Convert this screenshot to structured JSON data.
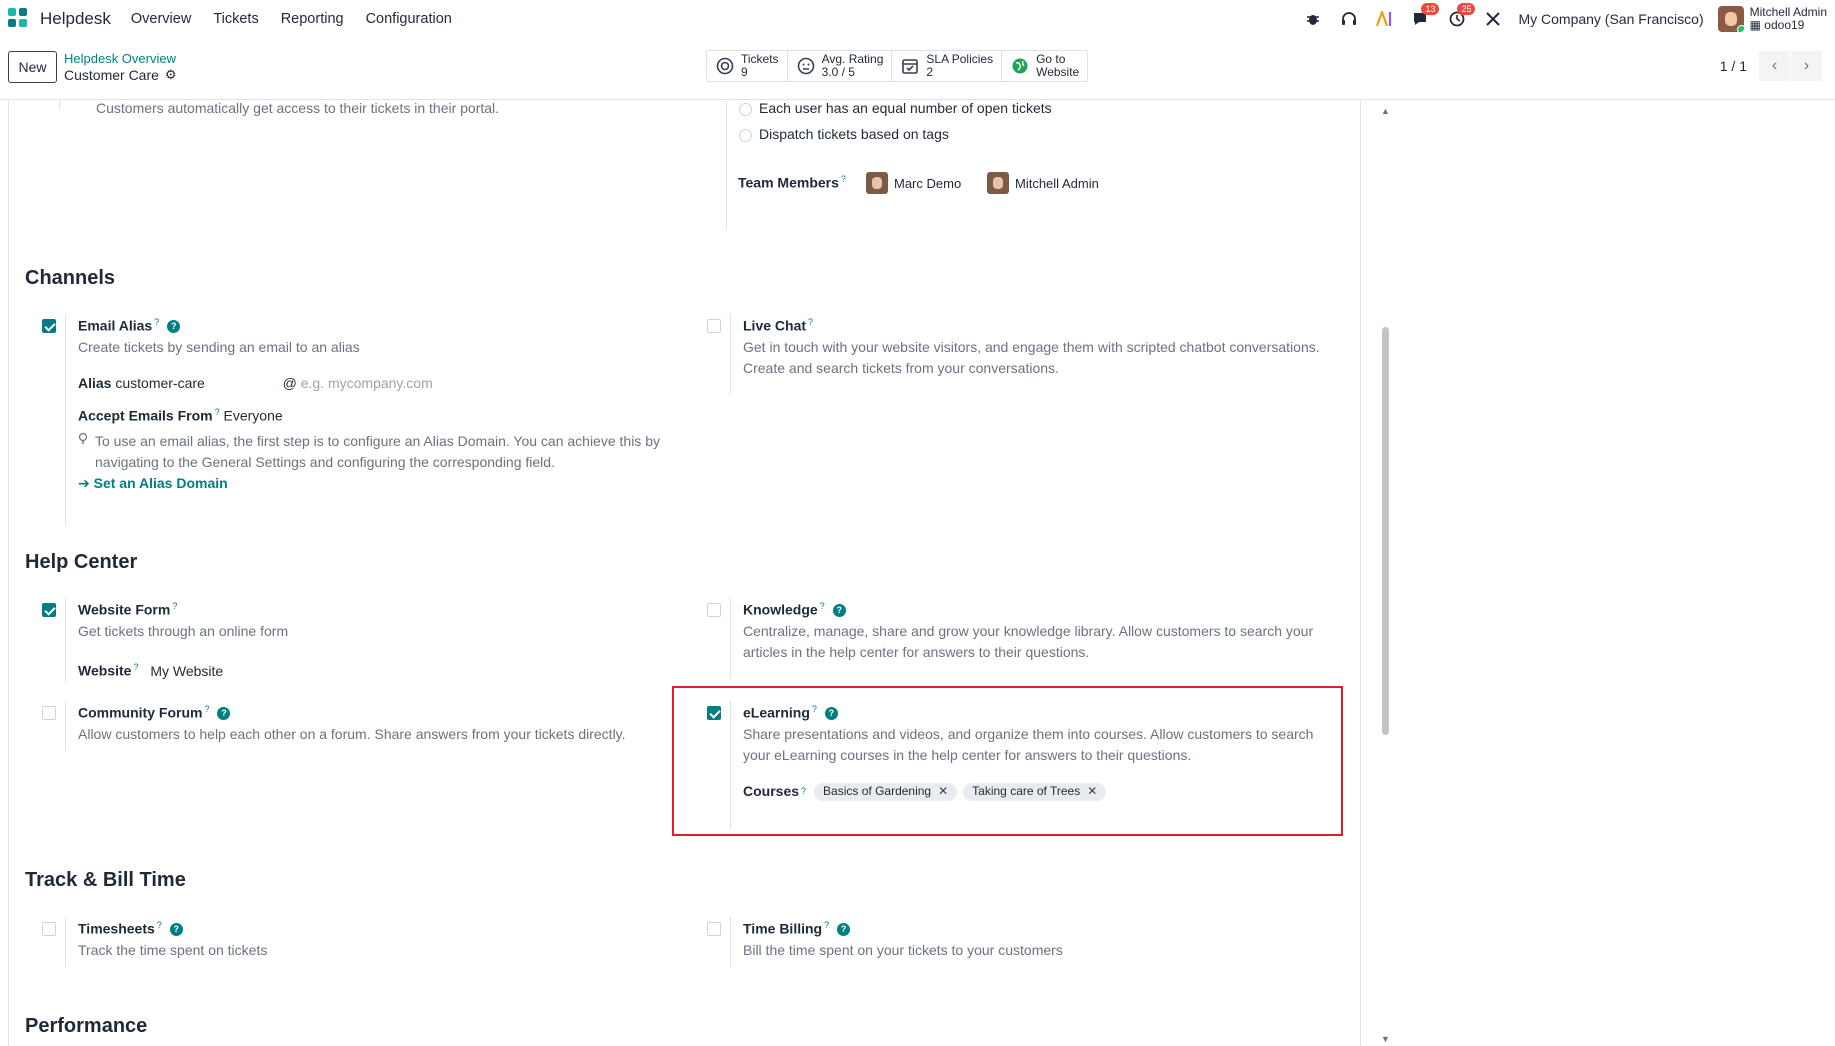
{
  "nav": {
    "app_name": "Helpdesk",
    "menu": [
      "Overview",
      "Tickets",
      "Reporting",
      "Configuration"
    ],
    "messages_badge": "13",
    "activities_badge": "25",
    "company": "My Company (San Francisco)",
    "user_name": "Mitchell Admin",
    "user_db": "odoo19",
    "icons": [
      "bug-icon",
      "headset-icon",
      "ai-icon",
      "chat-icon",
      "clock-icon",
      "tools-icon"
    ],
    "brand_colors": [
      "#1bb7ae",
      "#0f7a86"
    ]
  },
  "control": {
    "new_label": "New",
    "breadcrumb_parent": "Helpdesk Overview",
    "breadcrumb_current": "Customer Care",
    "stats": [
      {
        "label": "Tickets",
        "value": "9",
        "icon": "lifebuoy-icon"
      },
      {
        "label": "Avg. Rating",
        "value": "3.0 / 5",
        "icon": "smiley-icon"
      },
      {
        "label": "SLA Policies",
        "value": "2",
        "icon": "calendar-check-icon"
      },
      {
        "label": "Go to",
        "value": "Website",
        "icon": "globe-icon"
      }
    ],
    "pager": "1 / 1"
  },
  "top_section": {
    "portal_desc": "Customers automatically get access to their tickets in their portal.",
    "radio_equal": "Each user has an equal number of open tickets",
    "radio_tags": "Dispatch tickets based on tags",
    "team_members_label": "Team Members",
    "members": [
      "Marc Demo",
      "Mitchell Admin"
    ]
  },
  "channels": {
    "title": "Channels",
    "email_alias": {
      "label": "Email Alias",
      "checked": true,
      "desc": "Create tickets by sending an email to an alias",
      "alias_label": "Alias",
      "alias_value": "customer-care",
      "at": "@",
      "domain_placeholder": "e.g. mycompany.com",
      "accept_label": "Accept Emails From",
      "accept_value": "Everyone",
      "hint": "To use an email alias, the first step is to configure an Alias Domain. You can achieve this by navigating to the General Settings and configuring the corresponding field.",
      "link": "Set an Alias Domain"
    },
    "live_chat": {
      "label": "Live Chat",
      "checked": false,
      "desc": "Get in touch with your website visitors, and engage them with scripted chatbot conversations. Create and search tickets from your conversations."
    }
  },
  "help_center": {
    "title": "Help Center",
    "website_form": {
      "label": "Website Form",
      "checked": true,
      "desc": "Get tickets through an online form",
      "website_label": "Website",
      "website_value": "My Website"
    },
    "knowledge": {
      "label": "Knowledge",
      "checked": false,
      "desc": "Centralize, manage, share and grow your knowledge library. Allow customers to search your articles in the help center for answers to their questions."
    },
    "community_forum": {
      "label": "Community Forum",
      "checked": false,
      "desc": "Allow customers to help each other on a forum. Share answers from your tickets directly."
    },
    "elearning": {
      "label": "eLearning",
      "checked": true,
      "desc": "Share presentations and videos, and organize them into courses. Allow customers to search your eLearning courses in the help center for answers to their questions.",
      "courses_label": "Courses",
      "courses": [
        "Basics of Gardening",
        "Taking care of Trees"
      ]
    }
  },
  "track_bill": {
    "title": "Track & Bill Time",
    "timesheets": {
      "label": "Timesheets",
      "checked": false,
      "desc": "Track the time spent on tickets"
    },
    "time_billing": {
      "label": "Time Billing",
      "checked": false,
      "desc": "Bill the time spent on your tickets to your customers"
    }
  },
  "performance": {
    "title": "Performance"
  },
  "colors": {
    "accent": "#017e84",
    "highlight": "#e11d2a",
    "badge": "#e74c3c"
  },
  "help_glyph": "?",
  "tooltip_glyph": "?"
}
